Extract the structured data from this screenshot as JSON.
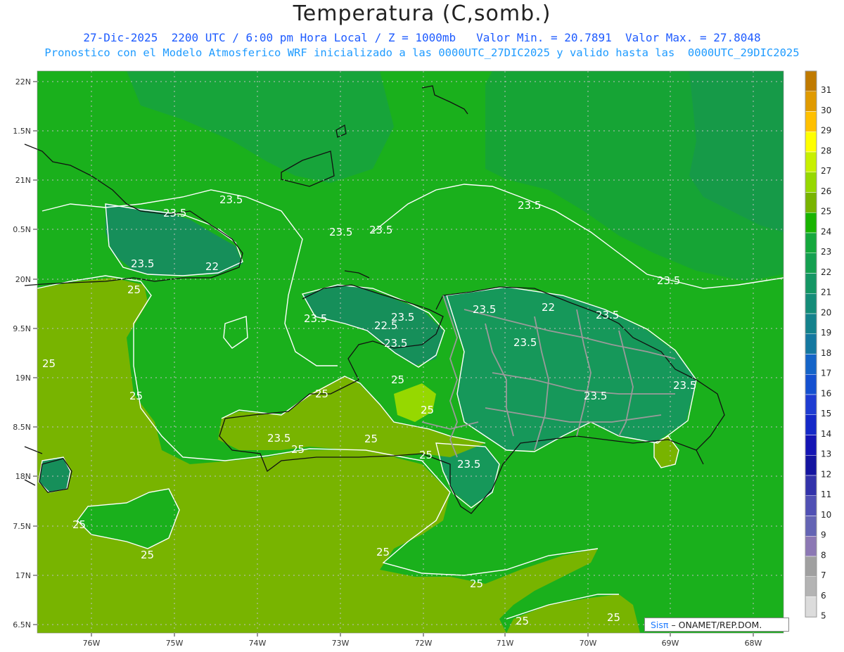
{
  "title": "Temperatura (C,somb.)",
  "subtitle_line1": "27-Dic-2025  2200 UTC / 6:00 pm Hora Local / Z = 1000mb   Valor Min. = 20.7891  Valor Max. = 27.8048",
  "subtitle_line2": "Pronostico con el Modelo Atmosferico WRF inicializado a las 0000UTC_27DIC2025 y valido hasta las  0000UTC_29DIC2025",
  "lat_labels": [
    "22N",
    "1.5N",
    "21N",
    "0.5N",
    "20N",
    "9.5N",
    "19N",
    "8.5N",
    "18N",
    "7.5N",
    "17N",
    "6.5N"
  ],
  "lon_labels": [
    "76W",
    "75W",
    "74W",
    "73W",
    "72W",
    "71W",
    "70W",
    "69W",
    "68W"
  ],
  "contour_labels": [
    "23.5",
    "23.5",
    "23.5",
    "23.5",
    "23.5",
    "22",
    "23.5",
    "25",
    "23.5",
    "22.5",
    "23.5",
    "23.5",
    "23.5",
    "22",
    "23.5",
    "23.5",
    "23.5",
    "23.5",
    "23.5",
    "25",
    "25",
    "25",
    "25",
    "23.5",
    "25",
    "25",
    "25",
    "25",
    "23.5",
    "25",
    "25",
    "25",
    "25",
    "25",
    "25"
  ],
  "colorbar": {
    "levels": [
      "31",
      "30",
      "29",
      "28",
      "27",
      "26",
      "25",
      "24",
      "23",
      "22",
      "21",
      "20",
      "19",
      "18",
      "17",
      "16",
      "15",
      "14",
      "13",
      "12",
      "11",
      "10",
      "9",
      "8",
      "7",
      "6",
      "5"
    ],
    "colors": [
      "#c07a00",
      "#e09a00",
      "#ffc000",
      "#ffff00",
      "#c8f000",
      "#96d800",
      "#78b400",
      "#18b400",
      "#14a83c",
      "#14a050",
      "#149664",
      "#148c78",
      "#14828c",
      "#1478a0",
      "#1464c8",
      "#1450d0",
      "#1e3cd2",
      "#1428c8",
      "#1414b4",
      "#1414a0",
      "#3232aa",
      "#5050b4",
      "#6464b4",
      "#8c78b4",
      "#a0a0a0",
      "#b4b4b4",
      "#dcdcdc"
    ]
  },
  "credit": {
    "brand": "Sisπ",
    "text": "– ONAMET/REP.DOM."
  }
}
